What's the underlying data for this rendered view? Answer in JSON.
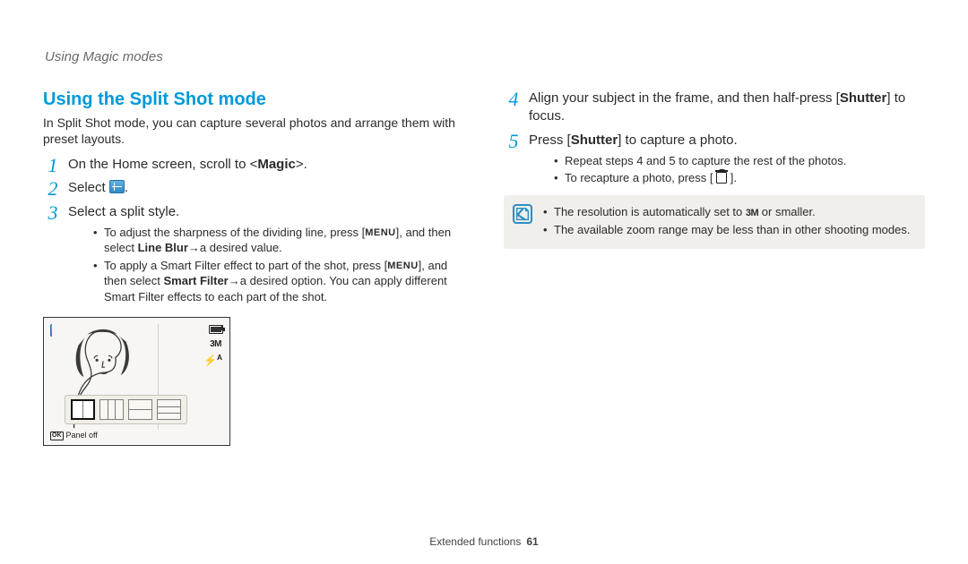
{
  "running_head": "Using Magic modes",
  "section_title": "Using the Split Shot mode",
  "intro": "In Split Shot mode, you can capture several photos and arrange them with preset layouts.",
  "steps_left": {
    "1": {
      "pre": "On the Home screen, scroll to <",
      "magic": "Magic",
      "post": ">."
    },
    "2": {
      "pre": "Select ",
      "post": "."
    },
    "3": {
      "text": "Select a split style.",
      "sub_a_pre": "To adjust the sharpness of the dividing line, press [",
      "sub_a_menu": "MENU",
      "sub_a_mid": "], and then select ",
      "sub_a_lineblur": "Line Blur",
      "sub_a_arrow": " → ",
      "sub_a_post": "a desired value.",
      "sub_b_pre": "To apply a Smart Filter effect to part of the shot, press [",
      "sub_b_menu": "MENU",
      "sub_b_mid": "], and then select ",
      "sub_b_sf": "Smart Filter",
      "sub_b_arrow": " → ",
      "sub_b_post": "a desired option. You can apply different Smart Filter effects to each part of the shot."
    }
  },
  "steps_right": {
    "4": {
      "pre": "Align your subject in the frame, and then half-press [",
      "shutter": "Shutter",
      "post": "] to focus."
    },
    "5": {
      "pre": "Press [",
      "shutter": "Shutter",
      "post": "] to capture a photo.",
      "sub_a": "Repeat steps 4 and 5 to capture the rest of the photos.",
      "sub_b_pre": "To recapture a photo, press [ ",
      "sub_b_post": " ]."
    }
  },
  "notebox": {
    "a_pre": "The resolution is automatically set to ",
    "a_res": "3M",
    "a_post": " or smaller.",
    "b": "The available zoom range may be less than in other shooting modes."
  },
  "lcd": {
    "res": "3M",
    "flash_auto": "A",
    "panel_off": "Panel off",
    "rec_indicator": "I"
  },
  "footer_label": "Extended functions",
  "page_number": "61"
}
